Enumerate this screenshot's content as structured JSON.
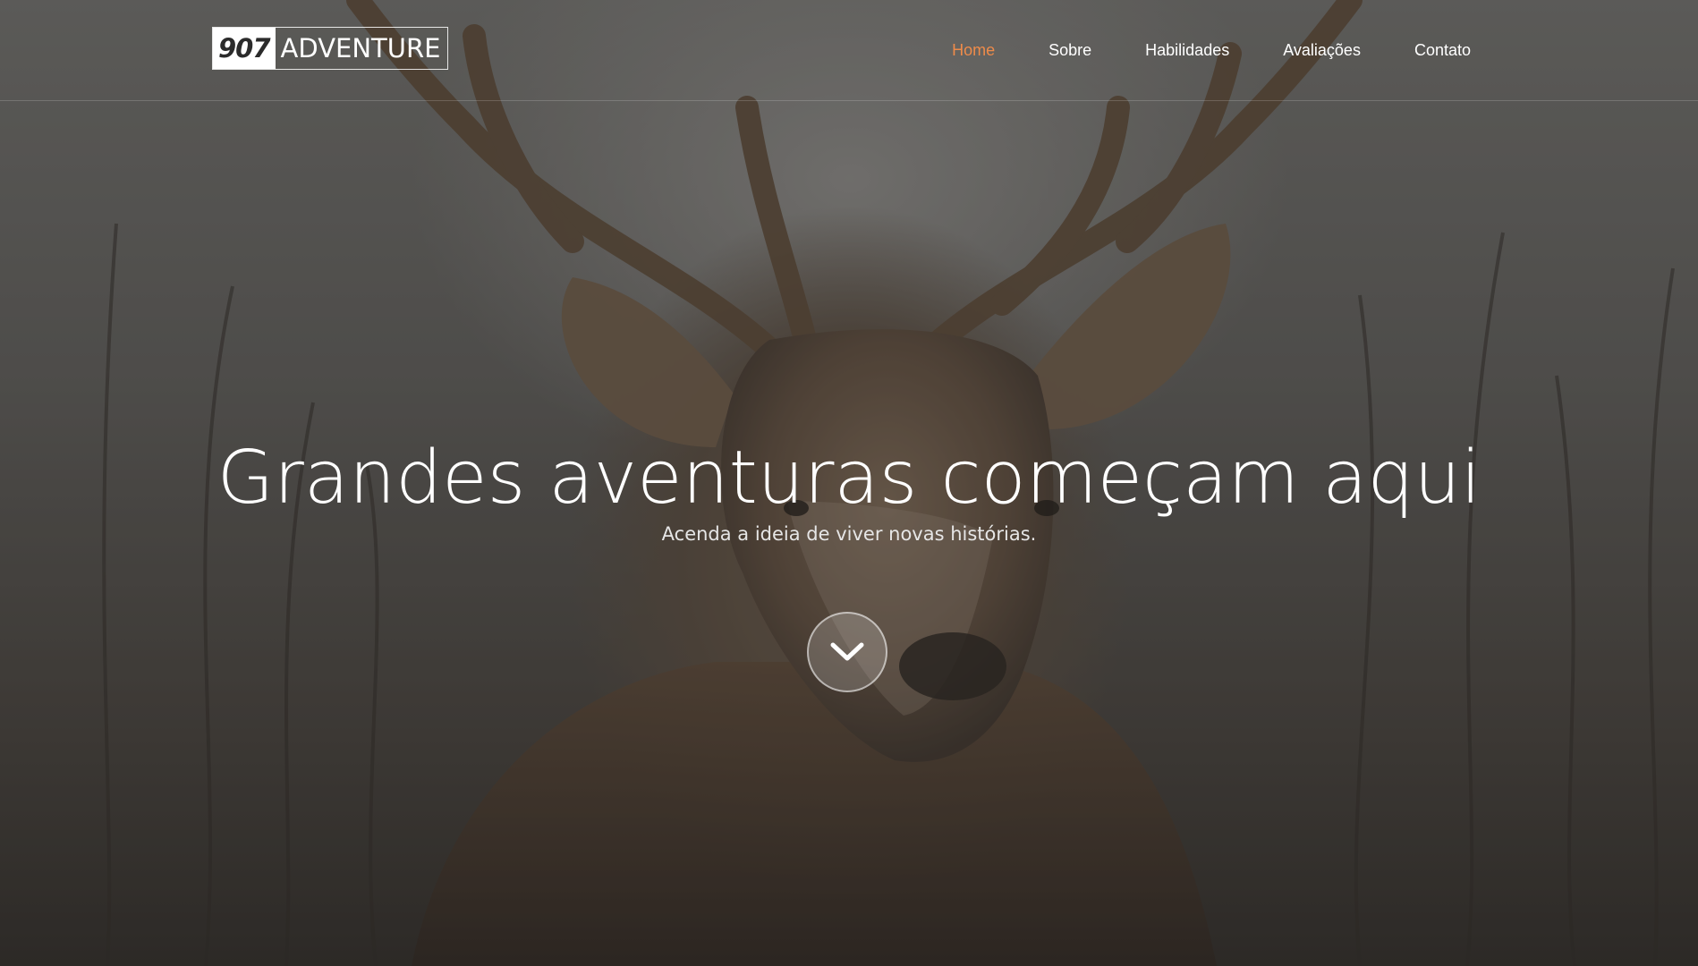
{
  "brand": {
    "logo_number": "907",
    "logo_word": "ADVENTURE"
  },
  "nav": {
    "items": [
      {
        "label": "Home",
        "active": true
      },
      {
        "label": "Sobre",
        "active": false
      },
      {
        "label": "Habilidades",
        "active": false
      },
      {
        "label": "Avaliações",
        "active": false
      },
      {
        "label": "Contato",
        "active": false
      }
    ]
  },
  "hero": {
    "title": "Grandes aventuras começam aqui",
    "subtitle": "Acenda a ideia de viver novas histórias.",
    "scroll_icon": "chevron-down-icon",
    "background_subject": "deer"
  },
  "colors": {
    "accent": "#ee8b4a",
    "text": "#ffffff"
  }
}
